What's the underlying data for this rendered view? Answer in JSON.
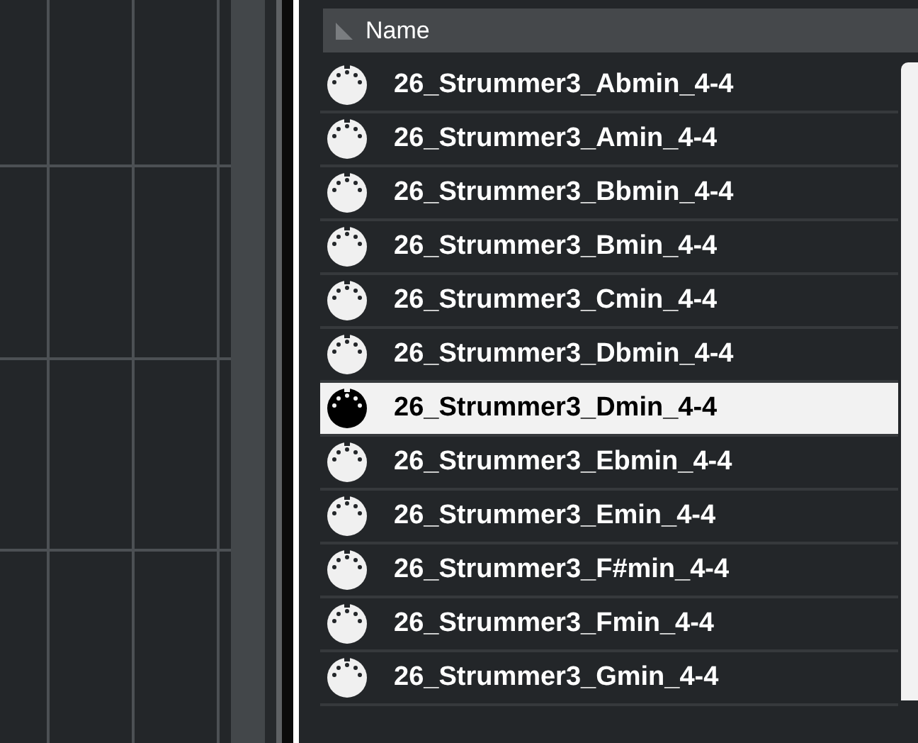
{
  "file_list": {
    "columns": [
      {
        "label": "Name"
      }
    ],
    "rows": [
      {
        "name": "26_Strummer3_Abmin_4-4",
        "selected": false
      },
      {
        "name": "26_Strummer3_Amin_4-4",
        "selected": false
      },
      {
        "name": "26_Strummer3_Bbmin_4-4",
        "selected": false
      },
      {
        "name": "26_Strummer3_Bmin_4-4",
        "selected": false
      },
      {
        "name": "26_Strummer3_Cmin_4-4",
        "selected": false
      },
      {
        "name": "26_Strummer3_Dbmin_4-4",
        "selected": false
      },
      {
        "name": "26_Strummer3_Dmin_4-4",
        "selected": true
      },
      {
        "name": "26_Strummer3_Ebmin_4-4",
        "selected": false
      },
      {
        "name": "26_Strummer3_Emin_4-4",
        "selected": false
      },
      {
        "name": "26_Strummer3_F#min_4-4",
        "selected": false
      },
      {
        "name": "26_Strummer3_Fmin_4-4",
        "selected": false
      },
      {
        "name": "26_Strummer3_Gmin_4-4",
        "selected": false
      }
    ]
  }
}
